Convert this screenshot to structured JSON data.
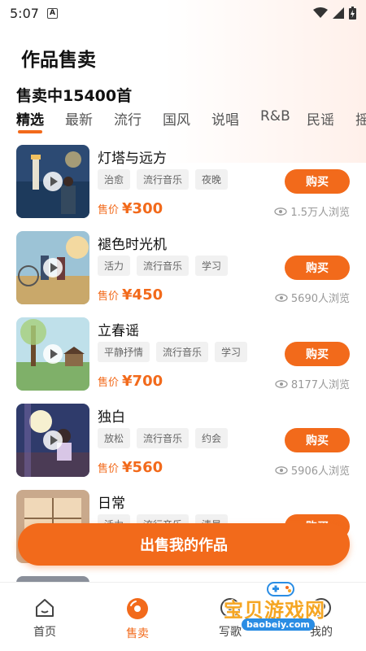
{
  "status_bar": {
    "time": "5:07",
    "app_icon_letter": "A"
  },
  "header": {
    "title": "作品售卖",
    "count_title": "售卖中15400首"
  },
  "tabs": [
    {
      "label": "精选",
      "active": true
    },
    {
      "label": "最新"
    },
    {
      "label": "流行"
    },
    {
      "label": "国风"
    },
    {
      "label": "说唱"
    },
    {
      "label": "R&B"
    },
    {
      "label": "民谣"
    },
    {
      "label": "摇"
    }
  ],
  "songs": [
    {
      "title": "灯塔与远方",
      "tags": [
        "治愈",
        "流行音乐",
        "夜晚"
      ],
      "price_label": "售价",
      "price": "¥300",
      "views": "1.5万人浏览",
      "buy_label": "购买"
    },
    {
      "title": "褪色时光机",
      "tags": [
        "活力",
        "流行音乐",
        "学习"
      ],
      "price_label": "售价",
      "price": "¥450",
      "views": "5690人浏览",
      "buy_label": "购买"
    },
    {
      "title": "立春谣",
      "tags": [
        "平静抒情",
        "流行音乐",
        "学习"
      ],
      "price_label": "售价",
      "price": "¥700",
      "views": "8177人浏览",
      "buy_label": "购买"
    },
    {
      "title": "独白",
      "tags": [
        "放松",
        "流行音乐",
        "约会"
      ],
      "price_label": "售价",
      "price": "¥560",
      "views": "5906人浏览",
      "buy_label": "购买"
    },
    {
      "title": "日常",
      "tags": [
        "活力",
        "流行音乐",
        "清晨"
      ],
      "price_label": "售价",
      "price": "",
      "views": "",
      "buy_label": "购买"
    }
  ],
  "sell_button": "出售我的作品",
  "bottom_nav": [
    {
      "label": "首页",
      "icon": "home-icon"
    },
    {
      "label": "售卖",
      "icon": "disc-icon",
      "active": true
    },
    {
      "label": "写歌",
      "icon": "write-icon"
    },
    {
      "label": "我的",
      "icon": "profile-icon"
    }
  ],
  "watermark": {
    "text": "宝贝游戏网",
    "url": "baobeiy.com"
  },
  "colors": {
    "accent": "#f26a1b",
    "tag_bg": "#f1f1f1",
    "muted": "#999999"
  }
}
